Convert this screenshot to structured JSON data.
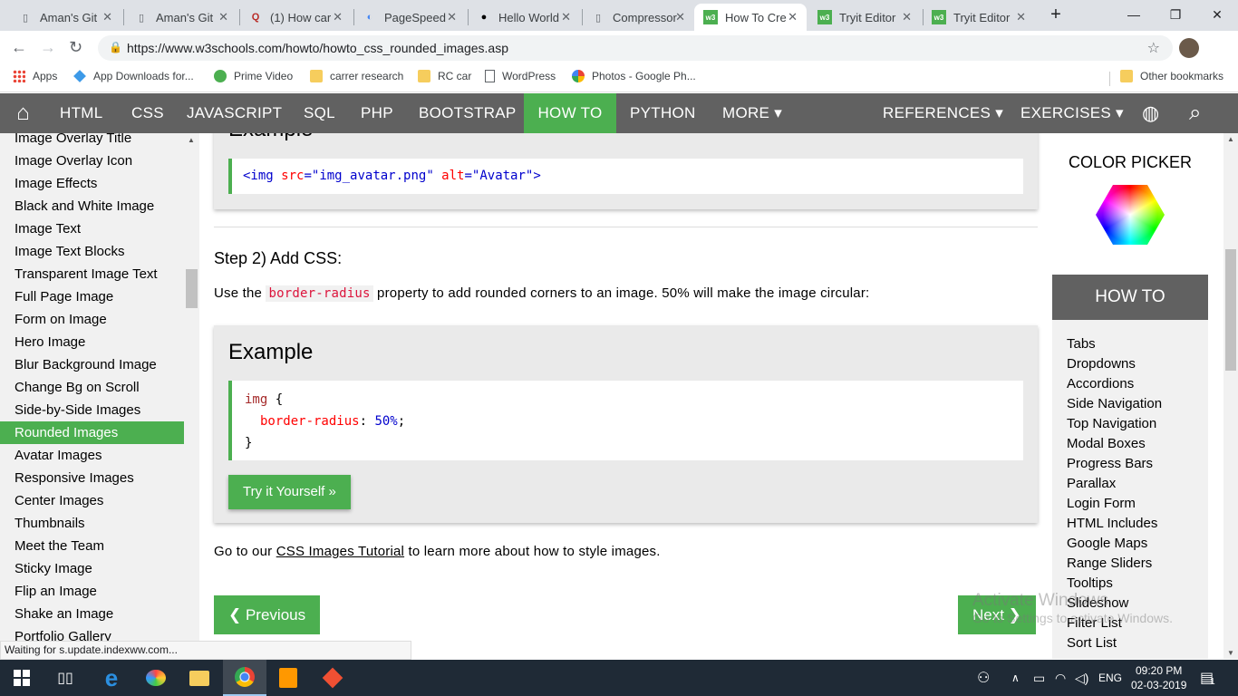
{
  "tabs": [
    {
      "title": "Aman's Git",
      "icon": "doc-icon"
    },
    {
      "title": "Aman's Git",
      "icon": "doc-icon"
    },
    {
      "title": "(1) How car",
      "icon": "quora-icon"
    },
    {
      "title": "PageSpeed",
      "icon": "pagespeed-icon"
    },
    {
      "title": "Hello World",
      "icon": "github-icon"
    },
    {
      "title": "Compressor",
      "icon": "doc-icon"
    },
    {
      "title": "How To Cre",
      "icon": "w3-icon"
    },
    {
      "title": "Tryit Editor",
      "icon": "w3-icon"
    },
    {
      "title": "Tryit Editor",
      "icon": "w3-icon"
    }
  ],
  "tab_close": "✕",
  "new_tab": "+",
  "window_controls": {
    "minimize": "—",
    "maximize": "❐",
    "close": "✕"
  },
  "address": {
    "url": "https://www.w3schools.com/howto/howto_css_rounded_images.asp",
    "back": "←",
    "forward": "→",
    "reload": "↻",
    "lock": "🔒",
    "star": "☆"
  },
  "bookmarks": [
    {
      "label": "Apps",
      "icon": "apps-icon"
    },
    {
      "label": "App Downloads for...",
      "icon": "dropbox-icon"
    },
    {
      "label": "Prime Video",
      "icon": "play-icon"
    },
    {
      "label": "carrer research",
      "icon": "folder-icon"
    },
    {
      "label": "RC car",
      "icon": "folder-icon"
    },
    {
      "label": "WordPress",
      "icon": "doc-icon"
    },
    {
      "label": "Photos - Google Ph...",
      "icon": "pinwheel-icon"
    }
  ],
  "other_bookmarks": "Other bookmarks",
  "topnav": {
    "home": "⌂",
    "items": [
      "HTML",
      "CSS",
      "JAVASCRIPT",
      "SQL",
      "PHP",
      "BOOTSTRAP",
      "HOW TO",
      "PYTHON",
      "MORE ▾"
    ],
    "active": "HOW TO",
    "right": [
      "REFERENCES ▾",
      "EXERCISES ▾"
    ],
    "globe": "◍",
    "search": "⌕"
  },
  "sidebar": {
    "items": [
      "Image Overlay Title",
      "Image Overlay Icon",
      "Image Effects",
      "Black and White Image",
      "Image Text",
      "Image Text Blocks",
      "Transparent Image Text",
      "Full Page Image",
      "Form on Image",
      "Hero Image",
      "Blur Background Image",
      "Change Bg on Scroll",
      "Side-by-Side Images",
      "Rounded Images",
      "Avatar Images",
      "Responsive Images",
      "Center Images",
      "Thumbnails",
      "Meet the Team",
      "Sticky Image",
      "Flip an Image",
      "Shake an Image",
      "Portfolio Gallery"
    ],
    "active": "Rounded Images",
    "scroll_up": "▲"
  },
  "main": {
    "example1_heading": "Example",
    "example1_code": {
      "open": "<img ",
      "attr1": "src",
      "eq1": "=",
      "val1": "\"img_avatar.png\"",
      "attr2": " alt",
      "eq2": "=",
      "val2": "\"Avatar\"",
      "close": ">"
    },
    "step2": "Step 2) Add CSS:",
    "para_pre": "Use the",
    "para_code": "border-radius",
    "para_post": "property to add rounded corners to an image. 50% will make the image circular:",
    "example2_heading": "Example",
    "code_line1_sel": "img",
    "code_line1_brace": " {",
    "code_line2_prop": "border-radius",
    "code_line2_colon": ": ",
    "code_line2_val": "50%",
    "code_line2_semi": ";",
    "code_line3": "}",
    "try_button": "Try it Yourself »",
    "outro_pre": "Go to our",
    "outro_link": "CSS Images Tutorial",
    "outro_post": "to learn more about how to style images.",
    "prev": "❮ Previous",
    "next": "Next ❯"
  },
  "right": {
    "color_picker": "COLOR PICKER",
    "howto_title": "HOW TO",
    "links": [
      "Tabs",
      "Dropdowns",
      "Accordions",
      "Side Navigation",
      "Top Navigation",
      "Modal Boxes",
      "Progress Bars",
      "Parallax",
      "Login Form",
      "HTML Includes",
      "Google Maps",
      "Range Sliders",
      "Tooltips",
      "Slideshow",
      "Filter List",
      "Sort List"
    ]
  },
  "status_bar": "Waiting for s.update.indexww.com...",
  "watermark": {
    "line1": "Activate Windows",
    "line2": "Go to Settings to activate Windows."
  },
  "taskbar": {
    "apps": [
      "windows-start-icon",
      "task-view-icon",
      "edge-icon",
      "paint-icon",
      "file-explorer-icon",
      "chrome-icon",
      "sublime-icon",
      "git-icon"
    ],
    "lang": "ENG",
    "time": "09:20 PM",
    "date": "02-03-2019",
    "notifications": "1"
  },
  "colors": {
    "accent_green": "#4caf50",
    "nav_gray": "#616161",
    "code_red": "#a52a2a",
    "code_blue": "#0000cd"
  }
}
